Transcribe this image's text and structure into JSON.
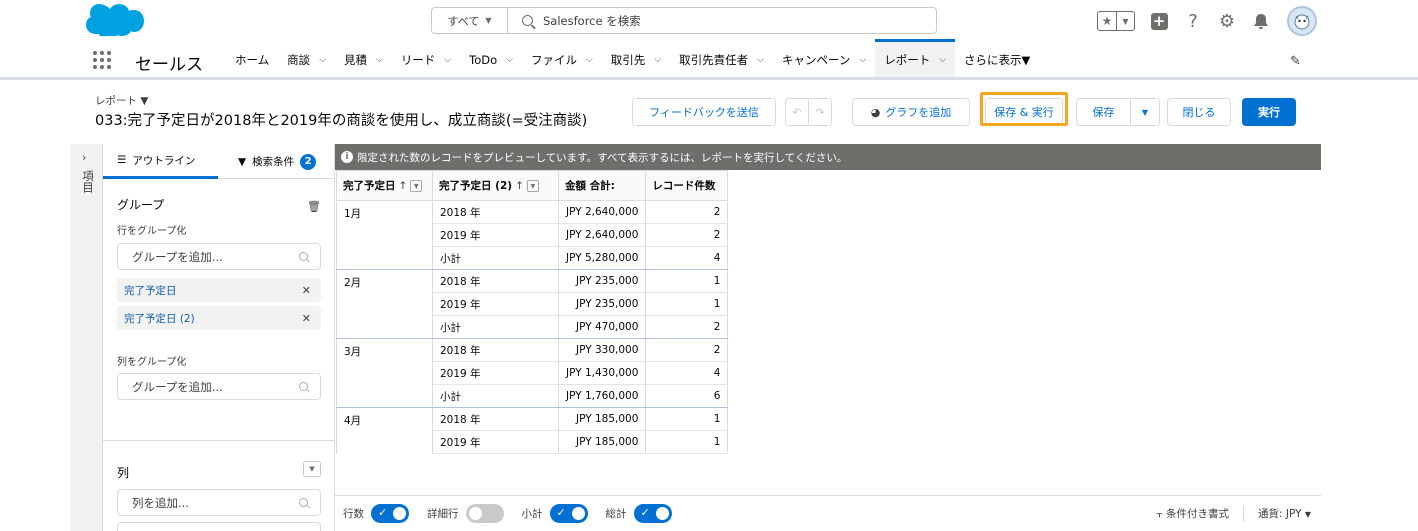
{
  "colors": {
    "brand": "#0070d2",
    "highlight": "#f5a623",
    "logo": "#00a1e0"
  },
  "header": {
    "search_scope": "すべて",
    "search_placeholder": "Salesforce を検索"
  },
  "app": {
    "name": "セールス",
    "nav": [
      {
        "label": "ホーム",
        "chevron": false
      },
      {
        "label": "商談",
        "chevron": true
      },
      {
        "label": "見積",
        "chevron": true
      },
      {
        "label": "リード",
        "chevron": true
      },
      {
        "label": "ToDo",
        "chevron": true
      },
      {
        "label": "ファイル",
        "chevron": true
      },
      {
        "label": "取引先",
        "chevron": true
      },
      {
        "label": "取引先責任者",
        "chevron": true
      },
      {
        "label": "キャンペーン",
        "chevron": true
      },
      {
        "label": "レポート",
        "chevron": true
      },
      {
        "label": "さらに表示▼",
        "chevron": false
      }
    ],
    "active_nav": "レポート"
  },
  "report": {
    "crumb": "レポート ▼",
    "title": "033:完了予定日が2018年と2019年の商談を使用し、成立商談(=受注商談)",
    "buttons": {
      "feedback": "フィードバックを送信",
      "add_chart": "グラフを追加",
      "save_run": "保存 & 実行",
      "save": "保存",
      "close": "閉じる",
      "run": "実行"
    }
  },
  "rail": {
    "label": "項目"
  },
  "panel": {
    "tab_outline": "アウトライン",
    "tab_filter": "検索条件",
    "filter_count": "2",
    "group_title": "グループ",
    "row_group_label": "行をグループ化",
    "add_group_placeholder": "グループを追加...",
    "row_groups": [
      "完了予定日",
      "完了予定日 (2)"
    ],
    "col_group_label": "列をグループ化",
    "add_col_group_placeholder": "グループを追加...",
    "columns_title": "列",
    "add_column_placeholder": "列を追加..."
  },
  "banner": "限定された数のレコードをプレビューしています。すべて表示するには、レポートを実行してください。",
  "table": {
    "headers": [
      "完了予定日",
      "完了予定日 (2)",
      "金額 合計:",
      "レコード件数"
    ],
    "groups": [
      {
        "month": "1月",
        "rows": [
          {
            "y": "2018 年",
            "amt": "JPY 2,640,000",
            "cnt": "2"
          },
          {
            "y": "2019 年",
            "amt": "JPY 2,640,000",
            "cnt": "2"
          },
          {
            "y": "小計",
            "amt": "JPY 5,280,000",
            "cnt": "4"
          }
        ]
      },
      {
        "month": "2月",
        "rows": [
          {
            "y": "2018 年",
            "amt": "JPY 235,000",
            "cnt": "1"
          },
          {
            "y": "2019 年",
            "amt": "JPY 235,000",
            "cnt": "1"
          },
          {
            "y": "小計",
            "amt": "JPY 470,000",
            "cnt": "2"
          }
        ]
      },
      {
        "month": "3月",
        "rows": [
          {
            "y": "2018 年",
            "amt": "JPY 330,000",
            "cnt": "2"
          },
          {
            "y": "2019 年",
            "amt": "JPY 1,430,000",
            "cnt": "4"
          },
          {
            "y": "小計",
            "amt": "JPY 1,760,000",
            "cnt": "6"
          }
        ]
      },
      {
        "month": "4月",
        "rows": [
          {
            "y": "2018 年",
            "amt": "JPY 185,000",
            "cnt": "1"
          },
          {
            "y": "2019 年",
            "amt": "JPY 185,000",
            "cnt": "1"
          }
        ]
      }
    ]
  },
  "footer": {
    "toggles": [
      {
        "label": "行数",
        "on": true
      },
      {
        "label": "詳細行",
        "on": false
      },
      {
        "label": "小計",
        "on": true
      },
      {
        "label": "総計",
        "on": true
      }
    ],
    "conditional_format": "条件付き書式",
    "currency": "通貨: JPY"
  }
}
